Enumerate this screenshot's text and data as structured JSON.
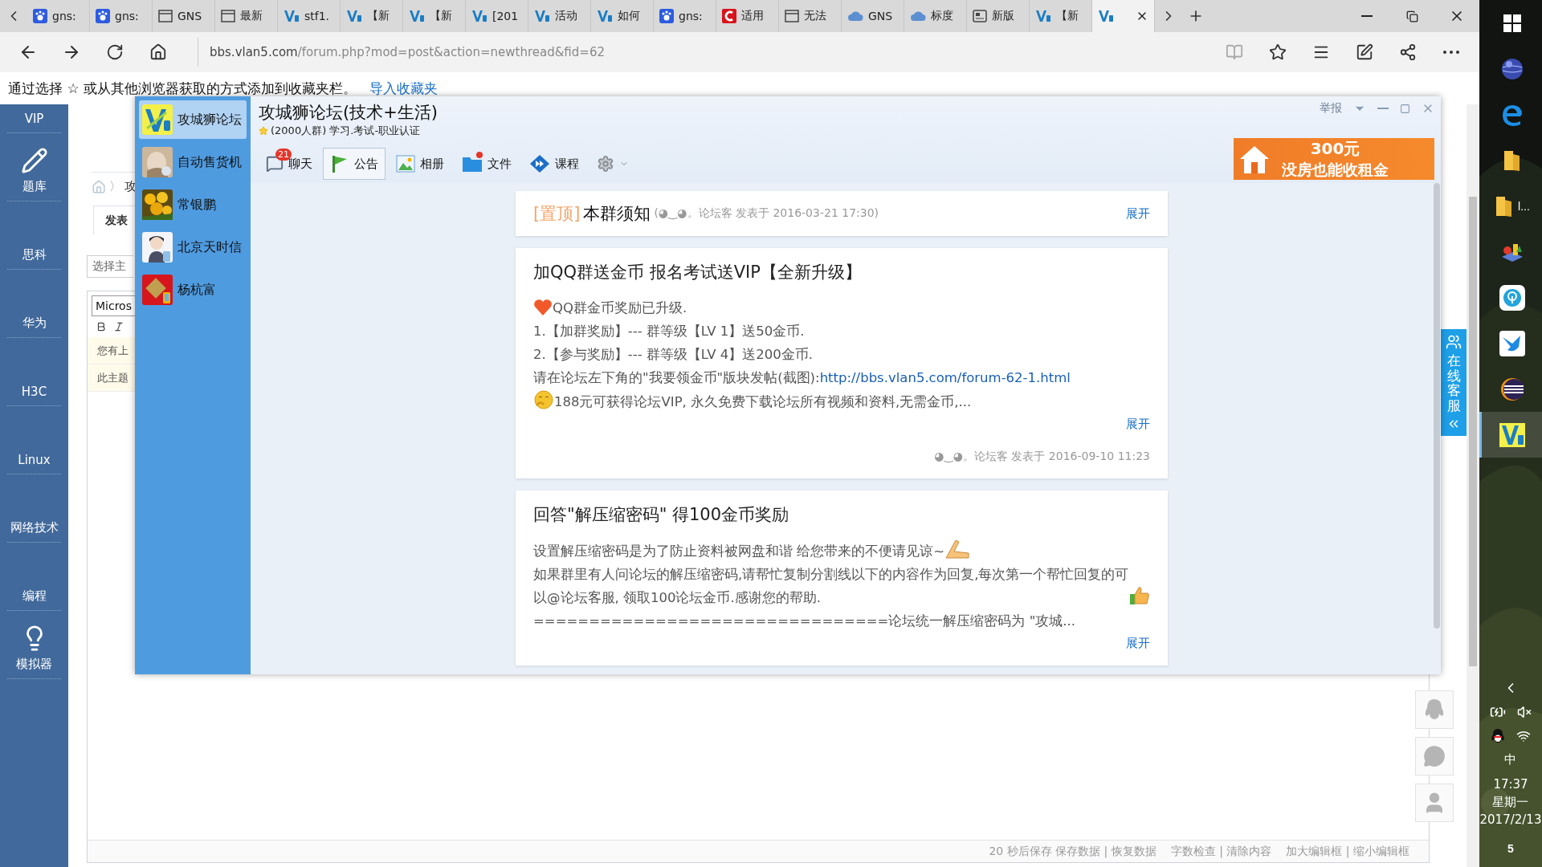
{
  "browser": {
    "tabs": [
      {
        "label": "gns:",
        "selected": false
      },
      {
        "label": "gns:",
        "selected": false
      },
      {
        "label": "GNS",
        "selected": false
      },
      {
        "label": "最新",
        "selected": false
      },
      {
        "label": "stf1.",
        "selected": false
      },
      {
        "label": "【新",
        "selected": false
      },
      {
        "label": "【新",
        "selected": false
      },
      {
        "label": "[201",
        "selected": false
      },
      {
        "label": "活动",
        "selected": false
      },
      {
        "label": "如何",
        "selected": false
      },
      {
        "label": "gns:",
        "selected": false
      },
      {
        "label": "适用",
        "selected": false
      },
      {
        "label": "无法",
        "selected": false
      },
      {
        "label": "GNS",
        "selected": false
      },
      {
        "label": "标度",
        "selected": false
      },
      {
        "label": "新版",
        "selected": false
      },
      {
        "label": "【新",
        "selected": false
      },
      {
        "selected": true
      }
    ],
    "address_host": "bbs.vlan5.com",
    "address_path": "/forum.php?mod=post&action=newthread&fid=62",
    "favorites_message": "通过选择 ☆ 或从其他浏览器获取的方式添加到收藏夹栏。",
    "favorites_link": "导入收藏夹"
  },
  "site_sidebar": [
    {
      "label": "VIP"
    },
    {
      "label": "题库"
    },
    {
      "label": "思科"
    },
    {
      "label": "华为"
    },
    {
      "label": "H3C"
    },
    {
      "label": "Linux"
    },
    {
      "label": "网络技术"
    },
    {
      "label": "编程"
    },
    {
      "label": "模拟器"
    }
  ],
  "editor_page": {
    "breadcrumb_separator": "〉",
    "breadcrumb": "攻",
    "tab": "发表",
    "subject_select": "选择主",
    "font_select": "Micros",
    "notices": [
      "您有上",
      "此主题"
    ],
    "status_bar": [
      "20 秒后保存 保存数据 | 恢复数据",
      "字数检查 | 清除内容",
      "加大编辑框 | 缩小编辑框"
    ]
  },
  "online_service": "在线客服",
  "qq_window": {
    "chats": [
      {
        "name": "攻城狮论坛",
        "selected": true
      },
      {
        "name": "自动售货机",
        "selected": false
      },
      {
        "name": "常银鹏",
        "selected": false
      },
      {
        "name": "北京天时信",
        "selected": false
      },
      {
        "name": "杨杭富",
        "selected": false
      }
    ],
    "title": "攻城狮论坛(技术+生活)",
    "info": "(2000人群) 学习.考试-职业认证",
    "report": "举报",
    "toolbar": [
      {
        "label": "聊天",
        "badge": "21",
        "selected": false
      },
      {
        "label": "公告",
        "selected": true
      },
      {
        "label": "相册",
        "selected": false
      },
      {
        "label": "文件",
        "dot": true,
        "selected": false
      },
      {
        "label": "课程",
        "selected": false
      }
    ],
    "ad": {
      "amount": "300元",
      "slogan": "没房也能收租金"
    },
    "posts": [
      {
        "kind": "pinned",
        "tag": "[置顶]",
        "title": "本群须知",
        "meta": "(◕‿◕。论坛客 发表于 2016-03-21 17:30)",
        "expand": "展开"
      },
      {
        "kind": "full",
        "title": "加QQ群送金币 报名考试送VIP【全新升级】",
        "lines": [
          {
            "text": "QQ群金币奖励已升级."
          },
          {
            "text": "1.【加群奖励】--- 群等级【LV 1】送50金币."
          },
          {
            "text": "2.【参与奖励】--- 群等级【LV 4】送200金币."
          },
          {
            "text": "请在论坛左下角的\"我要领金币\"版块发帖(截图): ",
            "link": "http://bbs.vlan5.com/forum-62-1.html"
          },
          {
            "text": "188元可获得论坛VIP, 永久免费下载论坛所有视频和资料,无需金币,..."
          }
        ],
        "expand": "展开",
        "footer": "◕‿◕。论坛客 发表于 2016-09-10 11:23"
      },
      {
        "kind": "full",
        "title": "回答\"解压缩密码\" 得100金币奖励",
        "lines": [
          {
            "text": "设置解压缩密码是为了防止资料被网盘和谐 给您带来的不便请见谅~"
          },
          {
            "text": "如果群里有人问论坛的解压缩密码,请帮忙复制分割线以下的内容作为回复,每次第一个帮忙回复的可以@论坛客服, 领取100论坛金币.感谢您的帮助."
          },
          {
            "text": "================================论坛统一解压缩密码为 \"攻城..."
          }
        ],
        "expand": "展开"
      }
    ]
  },
  "taskbar": {
    "apps": [
      {
        "selected": false
      },
      {
        "selected": false
      },
      {
        "selected": false
      },
      {
        "label": "l...",
        "selected": false
      },
      {
        "selected": false
      },
      {
        "selected": false
      },
      {
        "selected": false
      },
      {
        "selected": false
      },
      {
        "selected": true
      }
    ],
    "ime": "中",
    "time": "17:37",
    "weekday": "星期一",
    "date": "2017/2/13",
    "notifications": "5"
  }
}
